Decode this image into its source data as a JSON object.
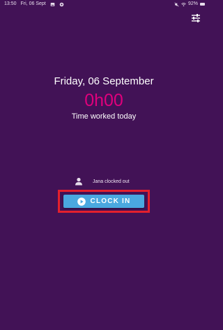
{
  "status_bar": {
    "time": "13:50",
    "date": "Fri, 06 Sept",
    "battery": "92%"
  },
  "colors": {
    "background": "#421256",
    "accent_pink": "#e0007c",
    "button_blue": "#4aa8e0",
    "highlight_red": "#e4202d"
  },
  "header": {
    "filter_icon": "sliders-icon"
  },
  "main": {
    "date": "Friday, 06 September",
    "time_worked": "0h00",
    "time_worked_label": "Time worked today"
  },
  "clock_status": {
    "icon": "person-icon",
    "text": "Jana clocked out"
  },
  "clock_in_button": {
    "label": "CLOCK IN",
    "icon": "play-icon"
  }
}
